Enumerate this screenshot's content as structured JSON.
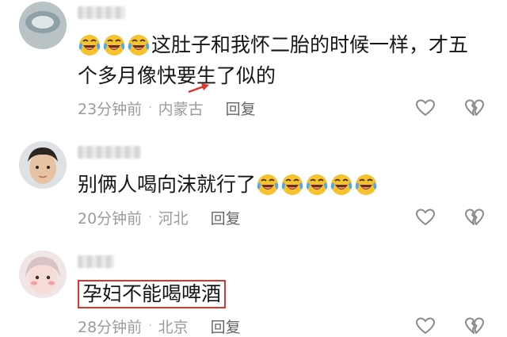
{
  "comments": [
    {
      "text_line1": "这肚子和我怀二胎的时候一样，才五",
      "text_line2": "个多月像快要生了似的",
      "time": "23分钟前",
      "location": "内蒙古",
      "reply": "回复",
      "emoji_before": 3,
      "emoji_after": 0
    },
    {
      "text_line1": "别俩人喝向沫就行了",
      "time": "20分钟前",
      "location": "河北",
      "reply": "回复",
      "emoji_before": 0,
      "emoji_after": 5
    },
    {
      "text_line1": "孕妇不能喝啤酒",
      "time": "28分钟前",
      "location": "北京",
      "reply": "回复",
      "emoji_before": 0,
      "emoji_after": 0,
      "highlighted": true
    }
  ],
  "icons": {
    "emoji": "laughing-crying-emoji",
    "like": "heart-outline-icon",
    "dislike": "broken-heart-icon"
  },
  "colors": {
    "highlight": "#e0332a",
    "meta_text": "#9a9a9a",
    "body_text": "#161616"
  }
}
